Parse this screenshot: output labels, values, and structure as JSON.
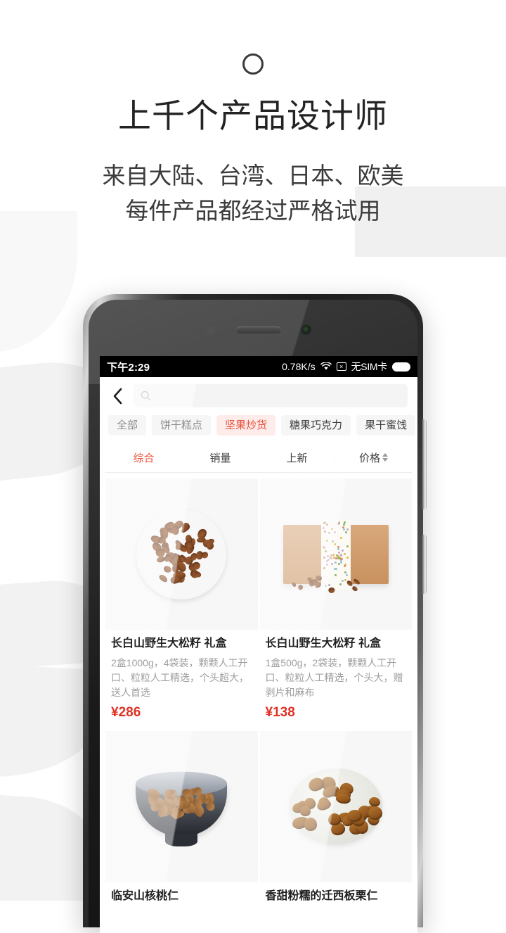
{
  "hero": {
    "brand_mark": "circle-outline",
    "title": "上千个产品设计师",
    "subtitle_line1": "来自大陆、台湾、日本、欧美",
    "subtitle_line2": "每件产品都经过严格试用"
  },
  "phone": {
    "status_bar": {
      "time": "下午2:29",
      "net_speed": "0.78K/s",
      "wifi_icon": "wifi-icon",
      "no_signal_icon": "no-signal-icon",
      "sim_label": "无SIM卡",
      "battery_icon": "battery-full-icon"
    },
    "header": {
      "back_icon": "back-chevron-icon",
      "search_icon": "search-icon",
      "search_value": "",
      "search_placeholder": ""
    },
    "categories": [
      {
        "label": "全部",
        "active": false,
        "dark": false
      },
      {
        "label": "饼干糕点",
        "active": false,
        "dark": false
      },
      {
        "label": "坚果炒货",
        "active": true,
        "dark": false
      },
      {
        "label": "糖果巧克力",
        "active": false,
        "dark": true
      },
      {
        "label": "果干蜜饯",
        "active": false,
        "dark": true
      }
    ],
    "sort_tabs": [
      {
        "label": "综合",
        "active": true,
        "has_arrows": false
      },
      {
        "label": "销量",
        "active": false,
        "has_arrows": false
      },
      {
        "label": "上新",
        "active": false,
        "has_arrows": false
      },
      {
        "label": "价格",
        "active": false,
        "has_arrows": true
      }
    ],
    "products": [
      {
        "title": "长白山野生大松籽 礼盒",
        "desc": "2盒1000g，4袋装，颗颗人工开口、粒粒人工精选，个头超大，送人首选",
        "price": "¥286",
        "image": "pine-nuts-on-wooden-plate"
      },
      {
        "title": "长白山野生大松籽 礼盒",
        "desc": "1盒500g，2袋装，颗颗人工开口、粒粒人工精选，个头大，赠剥片和麻布",
        "price": "¥138",
        "image": "kraft-gift-box"
      },
      {
        "title": "临安山核桃仁",
        "desc": "",
        "price": "",
        "image": "walnuts-in-dark-bowl"
      },
      {
        "title": "香甜粉糯的迁西板栗仁",
        "desc": "",
        "price": "",
        "image": "chestnuts-on-light-plate"
      }
    ]
  },
  "colors": {
    "accent": "#e8503a",
    "price": "#e03123",
    "chip_bg": "#f6f6f6",
    "chip_active_bg": "#fdecea",
    "page_bg": "#ffffff",
    "decor_gray": "#f0f0f0"
  }
}
